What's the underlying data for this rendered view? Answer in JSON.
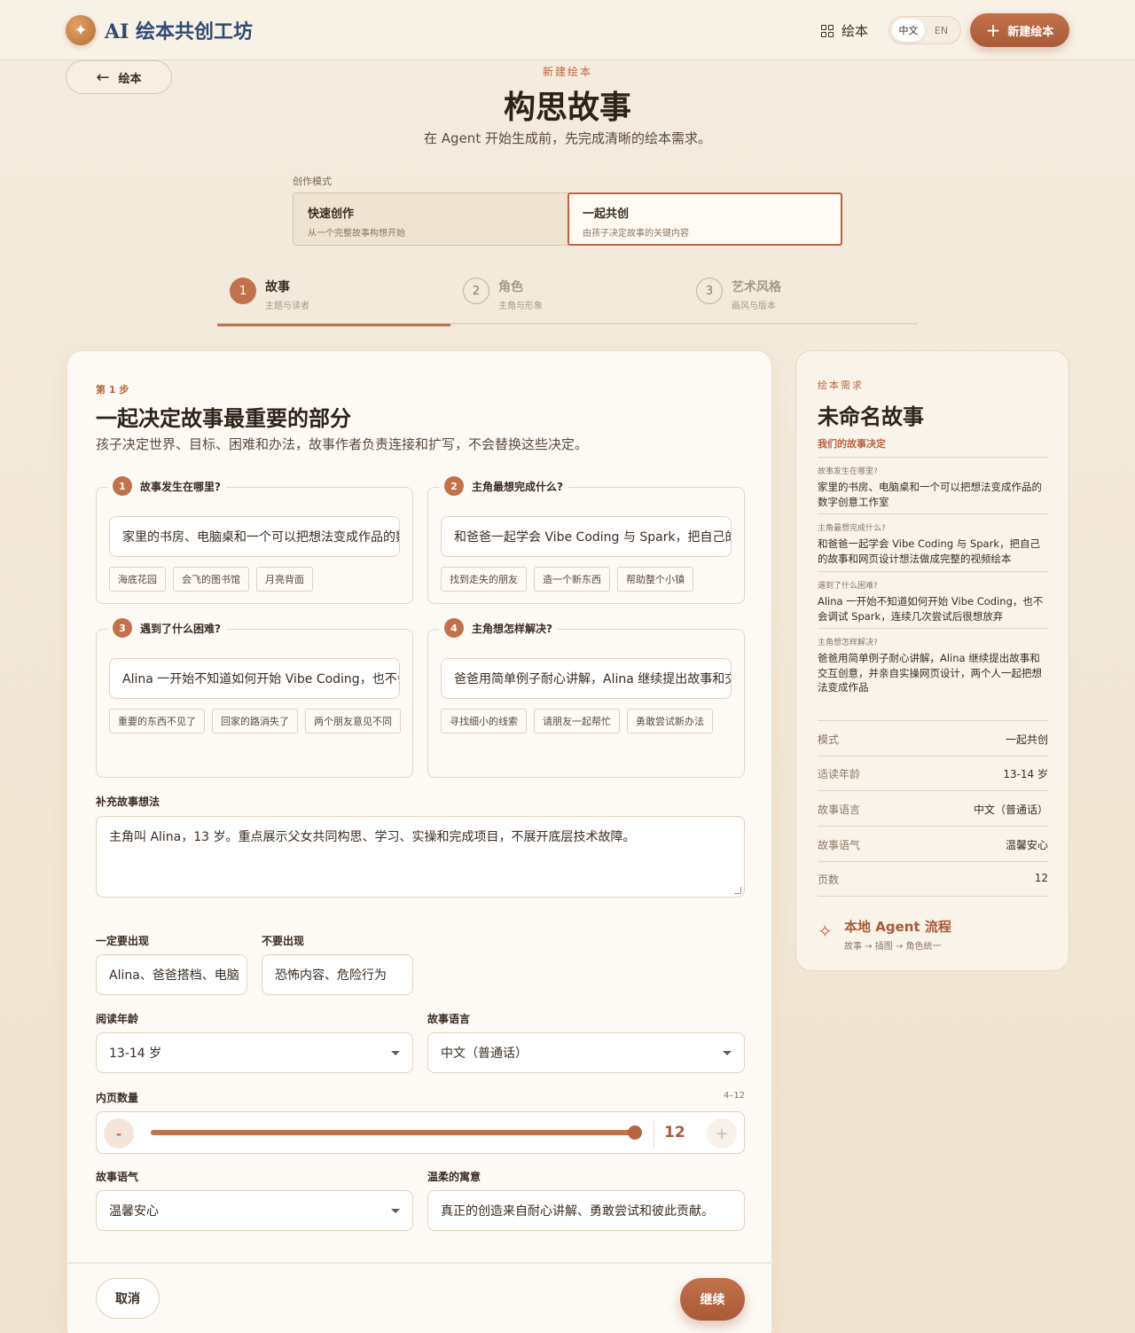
{
  "topbar": {
    "brand": "AI 绘本共创工坊",
    "nav_books": "绘本",
    "lang": [
      "中文",
      "EN"
    ],
    "new_button": "新建绘本"
  },
  "back_button": "绘本",
  "header": {
    "eyebrow": "新建绘本",
    "title": "构思故事",
    "subtitle": "在 Agent 开始生成前，先完成清晰的绘本需求。"
  },
  "mode": {
    "label": "创作模式",
    "options": [
      {
        "title": "快速创作",
        "desc": "从一个完整故事构想开始"
      },
      {
        "title": "一起共创",
        "desc": "由孩子决定故事的关键内容"
      }
    ],
    "selected": "一起共创"
  },
  "steps": [
    {
      "num": "1",
      "title": "故事",
      "desc": "主题与读者"
    },
    {
      "num": "2",
      "title": "角色",
      "desc": "主角与形象"
    },
    {
      "num": "3",
      "title": "艺术风格",
      "desc": "画风与版本"
    }
  ],
  "main": {
    "step_label": "第 1 步",
    "title": "一起决定故事最重要的部分",
    "subtitle": "孩子决定世界、目标、困难和办法，故事作者负责连接和扩写，不会替换这些决定。",
    "questions": [
      {
        "num": "1",
        "title": "故事发生在哪里?",
        "value": "家里的书房、电脑桌和一个可以把想法变成作品的数字创意工作室",
        "chips": [
          "海底花园",
          "会飞的图书馆",
          "月亮背面"
        ]
      },
      {
        "num": "2",
        "title": "主角最想完成什么?",
        "value": "和爸爸一起学会 Vibe Coding 与 Spark，把自己的故事和网页设计想法做成完整的视频绘本",
        "chips": [
          "找到走失的朋友",
          "造一个新东西",
          "帮助整个小镇"
        ]
      },
      {
        "num": "3",
        "title": "遇到了什么困难?",
        "value": "Alina 一开始不知道如何开始 Vibe Coding，也不会调试 Spark",
        "chips": [
          "重要的东西不见了",
          "回家的路消失了",
          "两个朋友意见不同"
        ]
      },
      {
        "num": "4",
        "title": "主角想怎样解决?",
        "value": "爸爸用简单例子耐心讲解，Alina 继续提出故事和交互创意",
        "chips": [
          "寻找细小的线索",
          "请朋友一起帮忙",
          "勇敢尝试新办法"
        ]
      }
    ],
    "extra_label": "补充故事想法",
    "extra_value": "主角叫 Alina，13 岁。重点展示父女共同构思、学习、实操和完成项目，不展开底层技术故障。",
    "must_label": "一定要出现",
    "must_value": "Alina、爸爸搭档、电脑",
    "avoid_label": "不要出现",
    "avoid_value": "恐怖内容、危险行为",
    "age_label": "阅读年龄",
    "age_value": "13-14 岁",
    "lang_label": "故事语言",
    "lang_value": "中文（普通话）",
    "pages_label": "内页数量",
    "pages_range": "4–12",
    "pages_min": 4,
    "pages_max": 12,
    "pages_value": "12",
    "minus": "-",
    "plus": "+",
    "tone_label": "故事语气",
    "tone_value": "温馨安心",
    "moral_label": "温柔的寓意",
    "moral_value": "真正的创造来自耐心讲解、勇敢尝试和彼此贡献。",
    "cancel": "取消",
    "continue": "继续"
  },
  "side": {
    "eyebrow": "绘本需求",
    "title": "未命名故事",
    "subtitle": "我们的故事决定",
    "qa": [
      {
        "q": "故事发生在哪里?",
        "a": "家里的书房、电脑桌和一个可以把想法变成作品的数字创意工作室"
      },
      {
        "q": "主角最想完成什么?",
        "a": "和爸爸一起学会 Vibe Coding 与 Spark，把自己的故事和网页设计想法做成完整的视频绘本"
      },
      {
        "q": "遇到了什么困难?",
        "a": "Alina 一开始不知道如何开始 Vibe Coding，也不会调试 Spark，连续几次尝试后很想放弃"
      },
      {
        "q": "主角想怎样解决?",
        "a": "爸爸用简单例子耐心讲解，Alina 继续提出故事和交互创意，并亲自实操网页设计，两个人一起把想法变成作品"
      }
    ],
    "summary": [
      {
        "k": "模式",
        "v": "一起共创"
      },
      {
        "k": "适读年龄",
        "v": "13-14 岁"
      },
      {
        "k": "故事语言",
        "v": "中文（普通话）"
      },
      {
        "k": "故事语气",
        "v": "温馨安心"
      },
      {
        "k": "页数",
        "v": "12"
      }
    ],
    "agent_title": "本地 Agent 流程",
    "agent_desc": "故事 → 插图 → 角色统一"
  },
  "colors": {
    "accent": "#c2724a",
    "brand": "#2f4a73",
    "background": "#f3e8d8"
  }
}
